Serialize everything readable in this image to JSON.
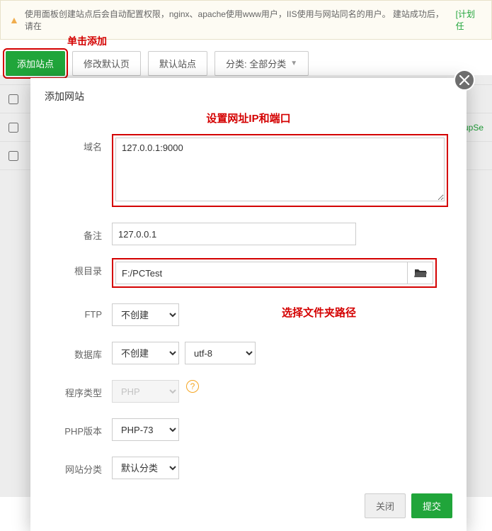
{
  "alert": {
    "text": "使用面板创建站点后会自动配置权限，nginx、apache使用www用户，IIS使用与网站同名的用户。 建站成功后，请在",
    "link": "[计划任"
  },
  "annotations": {
    "click_add": "单击添加",
    "set_ip_port": "设置网址IP和端口",
    "choose_folder": "选择文件夹路径"
  },
  "toolbar": {
    "add_site": "添加站点",
    "modify_default": "修改默认页",
    "default_site": "默认站点",
    "category": "分类: 全部分类"
  },
  "table": {
    "row3_text": "upSe"
  },
  "modal": {
    "title": "添加网站",
    "labels": {
      "domain": "域名",
      "note": "备注",
      "rootdir": "根目录",
      "ftp": "FTP",
      "database": "数据库",
      "prog_type": "程序类型",
      "php_ver": "PHP版本",
      "site_cat": "网站分类"
    },
    "values": {
      "domain": "127.0.0.1:9000",
      "note": "127.0.0.1",
      "rootdir": "F:/PCTest",
      "ftp": "不创建",
      "database": "不创建",
      "db_charset": "utf-8",
      "prog_type": "PHP",
      "php_ver": "PHP-73",
      "site_cat": "默认分类"
    },
    "buttons": {
      "close": "关闭",
      "submit": "提交"
    }
  }
}
